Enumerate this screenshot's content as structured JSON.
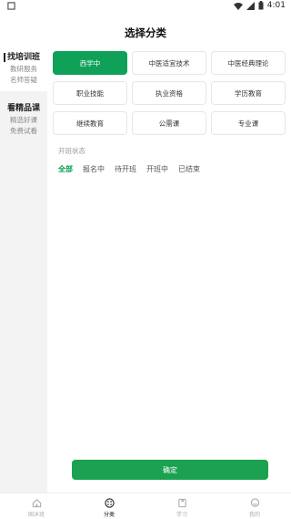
{
  "status_bar": {
    "time": "4:01"
  },
  "header": {
    "title": "选择分类"
  },
  "sidebar": {
    "groups": [
      {
        "title": "找培训班",
        "items": [
          "教研服务",
          "名师答疑"
        ]
      },
      {
        "title": "看精品课",
        "items": [
          "精选好课",
          "免费试看"
        ]
      }
    ]
  },
  "categories": [
    {
      "label": "西学中",
      "selected": true
    },
    {
      "label": "中医适宜技术",
      "selected": false
    },
    {
      "label": "中医经典理论",
      "selected": false
    },
    {
      "label": "职业技能",
      "selected": false
    },
    {
      "label": "执业资格",
      "selected": false
    },
    {
      "label": "学历教育",
      "selected": false
    },
    {
      "label": "继续教育",
      "selected": false
    },
    {
      "label": "公需课",
      "selected": false
    },
    {
      "label": "专业课",
      "selected": false
    }
  ],
  "filter_section": {
    "label": "开班状态",
    "options": [
      "全部",
      "报名中",
      "待开班",
      "开班中",
      "已结束"
    ],
    "active": "全部"
  },
  "confirm_label": "确定",
  "tabbar": {
    "items": [
      {
        "label": "固沐班",
        "icon": "home-icon"
      },
      {
        "label": "分类",
        "icon": "category-icon"
      },
      {
        "label": "学习",
        "icon": "study-icon"
      },
      {
        "label": "我的",
        "icon": "profile-icon"
      }
    ],
    "active_index": 1
  },
  "colors": {
    "accent": "#0fa158",
    "sidebar_bg": "#f3f3f3"
  }
}
